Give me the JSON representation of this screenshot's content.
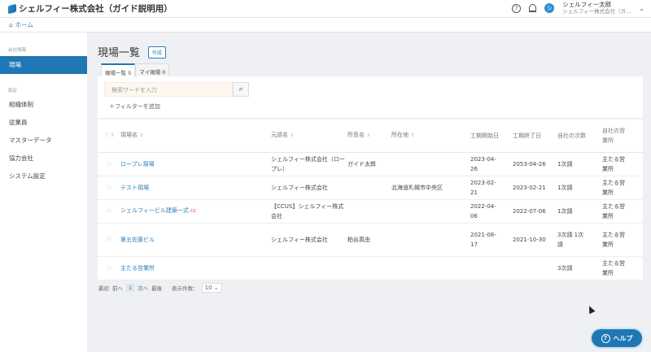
{
  "header": {
    "title": "シェルフィー株式会社（ガイド説明用）",
    "user_name": "シェルフィー太郎",
    "user_company": "シェルフィー株式会社（ガ...",
    "avatar_letter": "シ"
  },
  "breadcrumb": {
    "home": "ホーム"
  },
  "sidebar": {
    "section1": "会社情報",
    "active": "現場",
    "section2": "設定",
    "items": [
      "組織体制",
      "従業員",
      "マスターデータ",
      "協力会社",
      "システム設定"
    ]
  },
  "page": {
    "title": "現場一覧",
    "create": "作成",
    "tabs": [
      "現場一覧 5",
      "マイ現場 0"
    ],
    "search_placeholder": "検索ワードを入力",
    "add_filter": "フィルターを追加"
  },
  "table": {
    "headers": [
      "現場名",
      "元請名",
      "所長名",
      "所在地",
      "工期開始日",
      "工期終了日",
      "自社の次数",
      "自社の営業所"
    ],
    "rows": [
      {
        "name": "ロープレ現場",
        "prime": "シェルフィー株式会社（ロープレ）",
        "chief": "ガイド太郎",
        "location": "",
        "start": "2023-04-26",
        "end": "2053-04-26",
        "tier": "1次請",
        "office": "主たる営業所"
      },
      {
        "name": "テスト現場",
        "prime": "シェルフィー株式会社",
        "chief": "",
        "location": "北海道札幌市中央区",
        "start": "2023-02-21",
        "end": "2023-02-21",
        "tier": "1次請",
        "office": "主たる営業所"
      },
      {
        "name": "シェルフィービル建築一式",
        "badge": "CC",
        "prime": "【CCUS】シェルフィー株式会社",
        "chief": "",
        "location": "",
        "start": "2022-04-06",
        "end": "2022-07-06",
        "tier": "1次請",
        "office": "主たる営業所"
      },
      {
        "name": "第五佐藤ビル",
        "prime": "シェルフィー株式会社",
        "chief": "粕谷真由",
        "location": "",
        "start": "2021-08-17",
        "end": "2021-10-30",
        "tier": "3次請 1次請",
        "office": "主たる営業所"
      },
      {
        "name": "主たる営業所",
        "prime": "",
        "chief": "",
        "location": "",
        "start": "",
        "end": "",
        "tier": "3次請",
        "office": "主たる営業所"
      }
    ]
  },
  "pager": {
    "first": "最初",
    "prev": "前へ",
    "current": "1",
    "next": "次へ",
    "last": "最後",
    "per_page_label": "表示件数：",
    "per_page": "10"
  },
  "help": {
    "label": "ヘルプ"
  }
}
